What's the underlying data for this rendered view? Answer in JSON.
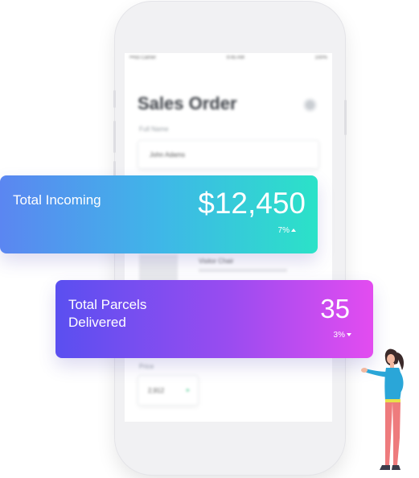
{
  "phone_screen": {
    "status_left": "•••oo Carrier",
    "status_time": "9:45 AM",
    "status_right": "100%",
    "title": "Sales Order",
    "field_label": "Full Name",
    "field_value": "John Adams",
    "product_name": "Visitor Chair",
    "price_label": "Price",
    "price_value": "2,912",
    "price_icon": "chevron-icon"
  },
  "cards": {
    "incoming": {
      "label": "Total Incoming",
      "value": "$12,450",
      "change": "7%",
      "trend": "up",
      "gradient": [
        "#5b86f1",
        "#2be2c8"
      ]
    },
    "parcels": {
      "label_line1": "Total Parcels",
      "label_line2": "Delivered",
      "value": "35",
      "change": "3%",
      "trend": "down",
      "gradient": [
        "#5a4ff0",
        "#e34cf0"
      ]
    }
  },
  "illustration": {
    "icon": "woman-pointing-illustration"
  }
}
